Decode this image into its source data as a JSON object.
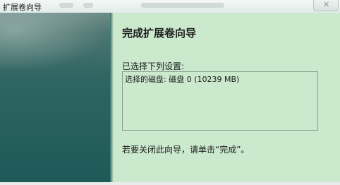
{
  "window": {
    "title": "扩展卷向导",
    "close_glyph": "✕",
    "close_icon": "close-icon"
  },
  "main": {
    "heading": "完成扩展卷向导",
    "settings_label": "已选择下列设置:",
    "settings_text": "选择的磁盘: 磁盘 0 (10239 MB)",
    "finish_hint": "若要关闭此向导，请单击“完成”。"
  },
  "colors": {
    "side_panel": "#1e5a58",
    "content_background": "#cbe9cd"
  }
}
